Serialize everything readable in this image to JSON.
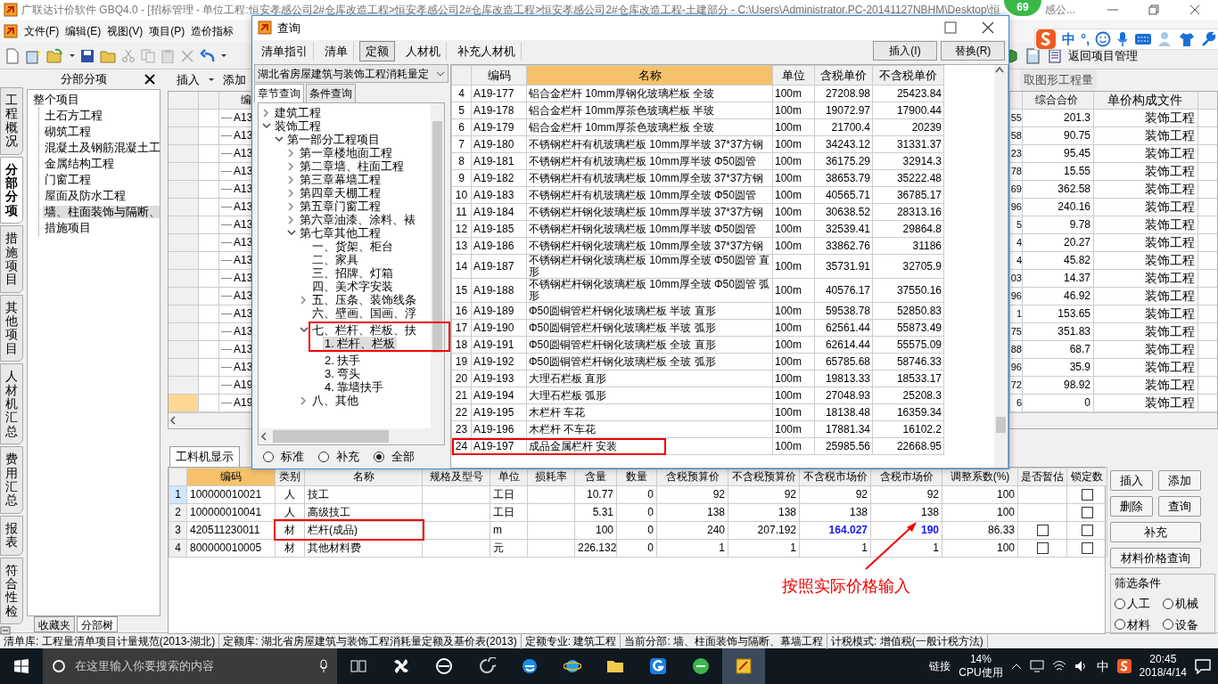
{
  "window": {
    "title": "广联达计价软件 GBQ4.0 - [招标管理 - 单位工程:恒安孝感公司2#仓库改造工程>恒安孝感公司2#仓库改造工程>恒安孝感公司2#仓库改造工程-土建部分 - C:\\Users\\Administrator.PC-20141127NBHM\\Desktop\\恒",
    "badge": "69",
    "title_tail": "感公..."
  },
  "menu": [
    "文件(F)",
    "编辑(E)",
    "视图(V)",
    "项目(P)",
    "造价指标"
  ],
  "ime": {
    "mode": "中",
    "punctuation": "°,"
  },
  "toolbar": {
    "return_button": "返回项目管理"
  },
  "side_tabs": [
    {
      "label": "工程概况",
      "selected": false
    },
    {
      "label": "分部分项",
      "selected": true
    },
    {
      "label": "措施项目",
      "selected": false
    },
    {
      "label": "其他项目",
      "selected": false
    },
    {
      "label": "人材机汇总",
      "selected": false
    },
    {
      "label": "费用汇总",
      "selected": false
    },
    {
      "label": "报表",
      "selected": false
    },
    {
      "label": "符合性检",
      "selected": false
    }
  ],
  "project_tree": {
    "title": "分部分项",
    "items": [
      {
        "label": "整个项目",
        "selected": false,
        "children": [
          {
            "label": "土石方工程",
            "selected": false
          },
          {
            "label": "砌筑工程",
            "selected": false
          },
          {
            "label": "混凝土及钢筋混凝土工",
            "selected": false
          },
          {
            "label": "金属结构工程",
            "selected": false
          },
          {
            "label": "门窗工程",
            "selected": false
          },
          {
            "label": "屋面及防水工程",
            "selected": false
          },
          {
            "label": "墙、柱面装饰与隔断、",
            "selected": true
          },
          {
            "label": "措施项目",
            "selected": false
          }
        ]
      }
    ],
    "tabs": [
      {
        "label": "收藏夹",
        "selected": false
      },
      {
        "label": "分部树",
        "selected": true
      }
    ]
  },
  "sub_toolbar": {
    "insert": "插入",
    "add": "添加",
    "extract": "取图形工程量"
  },
  "main_table": {
    "columns": [
      "编",
      "综合合价",
      "单价构成文件"
    ],
    "rows": [
      {
        "code": "A13",
        "column_2": "55",
        "total": "201.3",
        "file": "装饰工程",
        "selected": false
      },
      {
        "code": "A13",
        "column_2": "58",
        "total": "90.75",
        "file": "装饰工程",
        "selected": false
      },
      {
        "code": "A13",
        "column_2": "23",
        "total": "95.45",
        "file": "装饰工程",
        "selected": false
      },
      {
        "code": "A13",
        "column_2": "78",
        "total": "15.55",
        "file": "装饰工程",
        "selected": false
      },
      {
        "code": "A13",
        "column_2": "69",
        "total": "362.58",
        "file": "装饰工程",
        "selected": false
      },
      {
        "code": "A13",
        "column_2": "96",
        "total": "240.16",
        "file": "装饰工程",
        "selected": false
      },
      {
        "code": "A13",
        "column_2": "5",
        "total": "9.78",
        "file": "装饰工程",
        "selected": false
      },
      {
        "code": "A13",
        "column_2": "4",
        "total": "20.27",
        "file": "装饰工程",
        "selected": false
      },
      {
        "code": "A13",
        "column_2": "4",
        "total": "45.82",
        "file": "装饰工程",
        "selected": false
      },
      {
        "code": "A13",
        "column_2": "03",
        "total": "14.37",
        "file": "装饰工程",
        "selected": false
      },
      {
        "code": "A13",
        "column_2": "96",
        "total": "46.92",
        "file": "装饰工程",
        "selected": false
      },
      {
        "code": "A13",
        "column_2": "1",
        "total": "153.65",
        "file": "装饰工程",
        "selected": false
      },
      {
        "code": "A13",
        "column_2": "75",
        "total": "351.83",
        "file": "装饰工程",
        "selected": false
      },
      {
        "code": "A13",
        "column_2": "88",
        "total": "68.7",
        "file": "装饰工程",
        "selected": false
      },
      {
        "code": "A13",
        "column_2": "96",
        "total": "35.9",
        "file": "装饰工程",
        "selected": false
      },
      {
        "code": "A19",
        "column_2": "72",
        "total": "98.92",
        "file": "装饰工程",
        "selected": false
      },
      {
        "code": "A19",
        "column_2": "6",
        "total": "0",
        "file": "装饰工程",
        "selected": true
      }
    ]
  },
  "dialog": {
    "title": "查询",
    "tabs": [
      {
        "label": "清单指引",
        "selected": false
      },
      {
        "label": "清单",
        "selected": false
      },
      {
        "label": "定额",
        "selected": true
      },
      {
        "label": "人材机",
        "selected": false
      },
      {
        "label": "补充人材机",
        "selected": false
      }
    ],
    "buttons": [
      "插入(I)",
      "替换(R)"
    ],
    "library": "湖北省房屋建筑与装饰工程消耗量定",
    "search_tabs": [
      {
        "label": "章节查询",
        "selected": true
      },
      {
        "label": "条件查询",
        "selected": false
      }
    ],
    "tree": [
      {
        "label": "建筑工程",
        "expanded": false,
        "selected": false
      },
      {
        "label": "装饰工程",
        "expanded": true,
        "selected": false,
        "children": [
          {
            "label": "第一部分工程项目",
            "expanded": true,
            "selected": false,
            "children": [
              {
                "label": "第一章楼地面工程",
                "expanded": false,
                "selected": false
              },
              {
                "label": "第二章墙、柱面工程",
                "expanded": false,
                "selected": false
              },
              {
                "label": "第三章幕墙工程",
                "expanded": false,
                "selected": false
              },
              {
                "label": "第四章天棚工程",
                "expanded": false,
                "selected": false
              },
              {
                "label": "第五章门窗工程",
                "expanded": false,
                "selected": false
              },
              {
                "label": "第六章油漆、涂料、裱",
                "expanded": false,
                "selected": false
              },
              {
                "label": "第七章其他工程",
                "expanded": true,
                "selected": false,
                "children": [
                  {
                    "label": "一、货架、柜台",
                    "selected": false
                  },
                  {
                    "label": "二、家具",
                    "selected": false
                  },
                  {
                    "label": "三、招牌、灯箱",
                    "selected": false
                  },
                  {
                    "label": "四、美术字安装",
                    "selected": false
                  },
                  {
                    "label": "五、压条、装饰线条",
                    "expanded": false,
                    "selected": false
                  },
                  {
                    "label": "六、壁画、国画、浮",
                    "selected": false
                  },
                  {
                    "label": "七、栏杆、栏板、扶",
                    "expanded": true,
                    "selected": false,
                    "highlighted": true,
                    "children": [
                      {
                        "label": "1. 栏杆、栏板",
                        "selected": true,
                        "highlighted": true
                      },
                      {
                        "label": "2. 扶手",
                        "selected": false
                      },
                      {
                        "label": "3. 弯头",
                        "selected": false
                      },
                      {
                        "label": "4. 靠墙扶手",
                        "selected": false
                      }
                    ]
                  },
                  {
                    "label": "八、其他",
                    "expanded": false,
                    "selected": false
                  }
                ]
              }
            ]
          }
        ]
      }
    ],
    "filters": [
      {
        "label": "标准",
        "selected": false
      },
      {
        "label": "补充",
        "selected": false
      },
      {
        "label": "全部",
        "selected": true
      }
    ],
    "columns": [
      "编码",
      "名称",
      "单位",
      "含税单价",
      "不含税单价"
    ],
    "rows": [
      {
        "index": "4",
        "code": "A19-177",
        "name": "铝合金栏杆 10mm厚钢化玻璃栏板 全玻",
        "unit": "100m",
        "tax_price": "27208.98",
        "notax_price": "25423.84",
        "highlighted": false
      },
      {
        "index": "5",
        "code": "A19-178",
        "name": "铝合金栏杆 10mm厚茶色玻璃栏板 半玻",
        "unit": "100m",
        "tax_price": "19072.97",
        "notax_price": "17900.44",
        "highlighted": false
      },
      {
        "index": "6",
        "code": "A19-179",
        "name": "铝合金栏杆 10mm厚茶色玻璃栏板 全玻",
        "unit": "100m",
        "tax_price": "21700.4",
        "notax_price": "20239",
        "highlighted": false
      },
      {
        "index": "7",
        "code": "A19-180",
        "name": "不锈钢栏杆有机玻璃栏板 10mm厚半玻 37*37方钢",
        "unit": "100m",
        "tax_price": "34243.12",
        "notax_price": "31331.37",
        "highlighted": false
      },
      {
        "index": "8",
        "code": "A19-181",
        "name": "不锈钢栏杆有机玻璃栏板 10mm厚半玻 Φ50圆管",
        "unit": "100m",
        "tax_price": "36175.29",
        "notax_price": "32914.3",
        "highlighted": false
      },
      {
        "index": "9",
        "code": "A19-182",
        "name": "不锈钢栏杆有机玻璃栏板 10mm厚全玻 37*37方钢",
        "unit": "100m",
        "tax_price": "38653.79",
        "notax_price": "35222.48",
        "highlighted": false
      },
      {
        "index": "10",
        "code": "A19-183",
        "name": "不锈钢栏杆有机玻璃栏板 10mm厚全玻 Φ50圆管",
        "unit": "100m",
        "tax_price": "40565.71",
        "notax_price": "36785.17",
        "highlighted": false
      },
      {
        "index": "11",
        "code": "A19-184",
        "name": "不锈钢栏杆钢化玻璃栏板 10mm厚半玻 37*37方钢",
        "unit": "100m",
        "tax_price": "30638.52",
        "notax_price": "28313.16",
        "highlighted": false
      },
      {
        "index": "12",
        "code": "A19-185",
        "name": "不锈钢栏杆钢化玻璃栏板 10mm厚半玻 Φ50圆管",
        "unit": "100m",
        "tax_price": "32539.41",
        "notax_price": "29864.8",
        "highlighted": false
      },
      {
        "index": "13",
        "code": "A19-186",
        "name": "不锈钢栏杆钢化玻璃栏板 10mm厚全玻 37*37方钢",
        "unit": "100m",
        "tax_price": "33862.76",
        "notax_price": "31186",
        "highlighted": false
      },
      {
        "index": "14",
        "code": "A19-187",
        "name": "不锈钢栏杆钢化玻璃栏板 10mm厚全玻 Φ50圆管 直形",
        "unit": "100m",
        "tax_price": "35731.91",
        "notax_price": "32705.9",
        "highlighted": false
      },
      {
        "index": "15",
        "code": "A19-188",
        "name": "不锈钢栏杆钢化玻璃栏板 10mm厚全玻 Φ50圆管 弧形",
        "unit": "100m",
        "tax_price": "40576.17",
        "notax_price": "37550.16",
        "highlighted": false
      },
      {
        "index": "16",
        "code": "A19-189",
        "name": "Φ50圆铜管栏杆钢化玻璃栏板 半玻 直形",
        "unit": "100m",
        "tax_price": "59538.78",
        "notax_price": "52850.83",
        "highlighted": false
      },
      {
        "index": "17",
        "code": "A19-190",
        "name": "Φ50圆铜管栏杆钢化玻璃栏板 半玻 弧形",
        "unit": "100m",
        "tax_price": "62561.44",
        "notax_price": "55873.49",
        "highlighted": false
      },
      {
        "index": "18",
        "code": "A19-191",
        "name": "Φ50圆铜管栏杆钢化玻璃栏板 全玻 直形",
        "unit": "100m",
        "tax_price": "62614.44",
        "notax_price": "55575.09",
        "highlighted": false
      },
      {
        "index": "19",
        "code": "A19-192",
        "name": "Φ50圆铜管栏杆钢化玻璃栏板 全玻 弧形",
        "unit": "100m",
        "tax_price": "65785.68",
        "notax_price": "58746.33",
        "highlighted": false
      },
      {
        "index": "20",
        "code": "A19-193",
        "name": "大理石栏板 直形",
        "unit": "100m",
        "tax_price": "19813.33",
        "notax_price": "18533.17",
        "highlighted": false
      },
      {
        "index": "21",
        "code": "A19-194",
        "name": "大理石栏板 弧形",
        "unit": "100m",
        "tax_price": "27048.93",
        "notax_price": "25208.3",
        "highlighted": false
      },
      {
        "index": "22",
        "code": "A19-195",
        "name": "木栏杆 车花",
        "unit": "100m",
        "tax_price": "18138.48",
        "notax_price": "16359.34",
        "highlighted": false
      },
      {
        "index": "23",
        "code": "A19-196",
        "name": "木栏杆 不车花",
        "unit": "100m",
        "tax_price": "17881.34",
        "notax_price": "16102.2",
        "highlighted": false
      },
      {
        "index": "24",
        "code": "A19-197",
        "name": "成品金属栏杆 安装",
        "unit": "100m",
        "tax_price": "25985.56",
        "notax_price": "22668.95",
        "highlighted": true
      }
    ]
  },
  "bottom": {
    "tabs": [
      {
        "label": "工料机显示",
        "selected": true
      }
    ],
    "columns": [
      "编码",
      "类别",
      "名称",
      "规格及型号",
      "单位",
      "损耗率",
      "含量",
      "数量",
      "含税预算价",
      "不含税预算价",
      "不含税市场价",
      "含税市场价",
      "调整系数(%)",
      "是否暂估",
      "锁定数"
    ],
    "rows": [
      {
        "index": "1",
        "code": "100000010021",
        "category": "人",
        "name": "技工",
        "unit": "工日",
        "content": "10.77",
        "quantity": "0",
        "tax_budget_price": "92",
        "notax_budget_price": "92",
        "notax_market_price": "92",
        "tax_market_price": "92",
        "adjust_factor": "100",
        "locked": false,
        "selected": true,
        "price_edited": false,
        "highlighted": false
      },
      {
        "index": "2",
        "code": "100000010041",
        "category": "人",
        "name": "高级技工",
        "unit": "工日",
        "content": "5.31",
        "quantity": "0",
        "tax_budget_price": "138",
        "notax_budget_price": "138",
        "notax_market_price": "138",
        "tax_market_price": "138",
        "adjust_factor": "100",
        "locked": false,
        "selected": false,
        "price_edited": false,
        "highlighted": false
      },
      {
        "index": "3",
        "code": "420511230011",
        "category": "材",
        "name": "栏杆(成品)",
        "unit": "m",
        "content": "100",
        "quantity": "0",
        "tax_budget_price": "240",
        "notax_budget_price": "207.192",
        "notax_market_price": "164.027",
        "tax_market_price": "190",
        "adjust_factor": "86.33",
        "provisional": false,
        "locked": false,
        "selected": false,
        "price_edited": true,
        "highlighted": true
      },
      {
        "index": "4",
        "code": "800000010005",
        "category": "材",
        "name": "其他材料费",
        "unit": "元",
        "content": "226.132",
        "quantity": "0",
        "tax_budget_price": "1",
        "notax_budget_price": "1",
        "notax_market_price": "1",
        "tax_market_price": "1",
        "adjust_factor": "100",
        "provisional": false,
        "locked": false,
        "selected": false,
        "price_edited": false,
        "highlighted": false
      }
    ],
    "buttons": [
      "插入",
      "添加",
      "删除",
      "查询",
      "补充",
      "材料价格查询"
    ],
    "filter": {
      "title": "筛选条件",
      "options": [
        {
          "label": "人工",
          "selected": false
        },
        {
          "label": "机械",
          "selected": false
        },
        {
          "label": "材料",
          "selected": false
        },
        {
          "label": "设备",
          "selected": false
        }
      ]
    },
    "note": "按照实际价格输入"
  },
  "status_bar": [
    "清单库: 工程量清单项目计量规范(2013-湖北)",
    "定额库: 湖北省房屋建筑与装饰工程消耗量定额及基价表(2013)",
    "定额专业: 建筑工程",
    "当前分部: 墙、柱面装饰与隔断、幕墙工程",
    "计税模式: 增值税(一般计税方法)"
  ],
  "taskbar": {
    "search": {
      "placeholder": "在这里输入你要搜索的内容"
    },
    "links": "链接",
    "cpu": "14%",
    "cpu_label": "CPU使用",
    "ime": "中",
    "time": "20:45",
    "date": "2018/4/14"
  }
}
